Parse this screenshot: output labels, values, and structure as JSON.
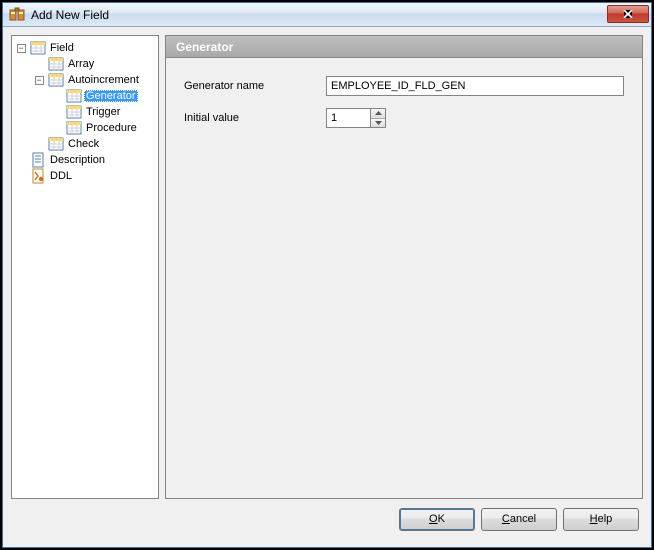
{
  "window": {
    "title": "Add New Field"
  },
  "panel": {
    "title": "Generator",
    "generator_name_label": "Generator name",
    "generator_name_value": "EMPLOYEE_ID_FLD_GEN",
    "initial_value_label": "Initial value",
    "initial_value_value": "1"
  },
  "tree": {
    "field": "Field",
    "array": "Array",
    "autoincrement": "Autoincrement",
    "generator": "Generator",
    "trigger": "Trigger",
    "procedure": "Procedure",
    "check": "Check",
    "description": "Description",
    "ddl": "DDL"
  },
  "buttons": {
    "ok_prefix": "",
    "ok_mnemonic": "O",
    "ok_suffix": "K",
    "cancel_prefix": "",
    "cancel_mnemonic": "C",
    "cancel_suffix": "ancel",
    "help_prefix": "",
    "help_mnemonic": "H",
    "help_suffix": "elp"
  }
}
